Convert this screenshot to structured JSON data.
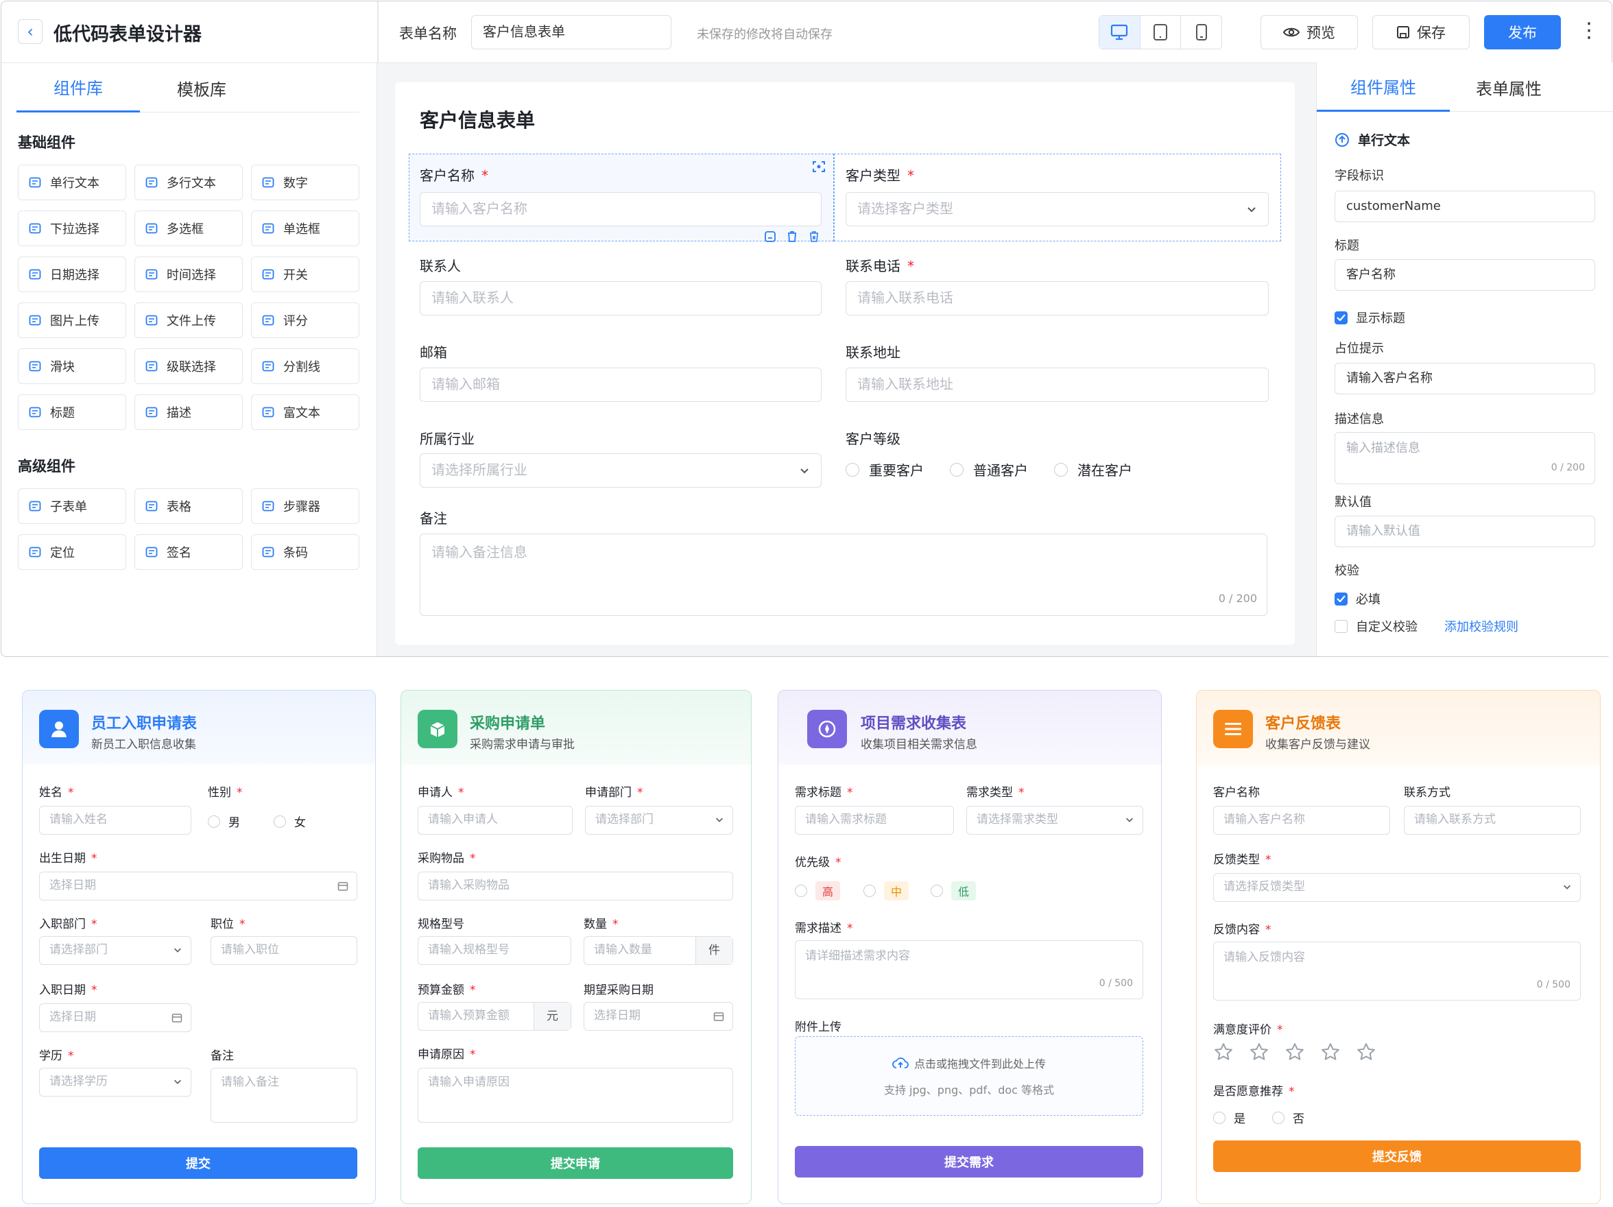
{
  "app": {
    "title": "低代码表单设计器",
    "form_name_label": "表单名称",
    "form_name_value": "客户信息表单",
    "autosave": "未保存的修改将自动保存",
    "preview": "预览",
    "save": "保存",
    "publish": "发布"
  },
  "left": {
    "tabs": [
      "组件库",
      "模板库"
    ],
    "basic_title": "基础组件",
    "basic": [
      "单行文本",
      "多行文本",
      "数字",
      "下拉选择",
      "多选框",
      "单选框",
      "日期选择",
      "时间选择",
      "开关",
      "图片上传",
      "文件上传",
      "评分",
      "滑块",
      "级联选择",
      "分割线",
      "标题",
      "描述",
      "富文本"
    ],
    "advanced_title": "高级组件",
    "advanced": [
      "子表单",
      "表格",
      "步骤器",
      "定位",
      "签名",
      "条码"
    ]
  },
  "canvas": {
    "title": "客户信息表单",
    "f1_label": "客户名称",
    "f1_ph": "请输入客户名称",
    "f2_label": "客户类型",
    "f2_ph": "请选择客户类型",
    "f3_label": "联系人",
    "f3_ph": "请输入联系人",
    "f4_label": "联系电话",
    "f4_ph": "请输入联系电话",
    "f5_label": "邮箱",
    "f5_ph": "请输入邮箱",
    "f6_label": "联系地址",
    "f6_ph": "请输入联系地址",
    "f7_label": "所属行业",
    "f7_ph": "请选择所属行业",
    "f8_label": "客户等级",
    "levels": [
      "重要客户",
      "普通客户",
      "潜在客户"
    ],
    "f9_label": "备注",
    "f9_ph": "请输入备注信息",
    "f9_count": "0 / 200"
  },
  "props": {
    "tabs": [
      "组件属性",
      "表单属性"
    ],
    "component": "单行文本",
    "field_id_label": "字段标识",
    "field_id": "customerName",
    "title_label": "标题",
    "title_value": "客户名称",
    "show_title": "显示标题",
    "placeholder_label": "占位提示",
    "placeholder_value": "请输入客户名称",
    "desc_label": "描述信息",
    "desc_ph": "输入描述信息",
    "desc_count": "0 / 200",
    "default_label": "默认值",
    "default_ph": "请输入默认值",
    "validate_label": "校验",
    "required": "必填",
    "custom": "自定义校验",
    "add_rule": "添加校验规则"
  },
  "cards": {
    "c1": {
      "title": "员工入职申请表",
      "sub": "新员工入职信息收集",
      "name_l": "姓名",
      "name_ph": "请输入姓名",
      "gender_l": "性别",
      "male": "男",
      "female": "女",
      "birth_l": "出生日期",
      "birth_ph": "选择日期",
      "dept_l": "入职部门",
      "dept_ph": "请选择部门",
      "pos_l": "职位",
      "pos_ph": "请输入职位",
      "join_l": "入职日期",
      "join_ph": "选择日期",
      "edu_l": "学历",
      "edu_ph": "请选择学历",
      "note_l": "备注",
      "note_ph": "请输入备注",
      "submit": "提交"
    },
    "c2": {
      "title": "采购申请单",
      "sub": "采购需求申请与审批",
      "app_l": "申请人",
      "app_ph": "请输入申请人",
      "dept_l": "申请部门",
      "dept_ph": "请选择部门",
      "item_l": "采购物品",
      "item_ph": "请输入采购物品",
      "spec_l": "规格型号",
      "spec_ph": "请输入规格型号",
      "qty_l": "数量",
      "qty_ph": "请输入数量",
      "qty_unit": "件",
      "budget_l": "预算金额",
      "budget_ph": "请输入预算金额",
      "budget_unit": "元",
      "date_l": "期望采购日期",
      "date_ph": "选择日期",
      "reason_l": "申请原因",
      "reason_ph": "请输入申请原因",
      "submit": "提交申请"
    },
    "c3": {
      "title": "项目需求收集表",
      "sub": "收集项目相关需求信息",
      "t_l": "需求标题",
      "t_ph": "请输入需求标题",
      "type_l": "需求类型",
      "type_ph": "请选择需求类型",
      "pri_l": "优先级",
      "high": "高",
      "mid": "中",
      "low": "低",
      "desc_l": "需求描述",
      "desc_ph": "请详细描述需求内容",
      "desc_count": "0 / 500",
      "att_l": "附件上传",
      "att_hint": "点击或拖拽文件到此处上传",
      "att_fmt": "支持 jpg、png、pdf、doc 等格式",
      "submit": "提交需求"
    },
    "c4": {
      "title": "客户反馈表",
      "sub": "收集客户反馈与建议",
      "cn_l": "客户名称",
      "cn_ph": "请输入客户名称",
      "ct_l": "联系方式",
      "ct_ph": "请输入联系方式",
      "ft_l": "反馈类型",
      "ft_ph": "请选择反馈类型",
      "fc_l": "反馈内容",
      "fc_ph": "请输入反馈内容",
      "fc_count": "0 / 500",
      "rate_l": "满意度评价",
      "rate": 0,
      "rec_l": "是否愿意推荐",
      "yes": "是",
      "no": "否",
      "submit": "提交反馈"
    }
  },
  "colors": {
    "primary": "#2b7cf6",
    "green": "#3fba7f",
    "purple": "#7b68e0",
    "orange": "#f78a1d"
  }
}
